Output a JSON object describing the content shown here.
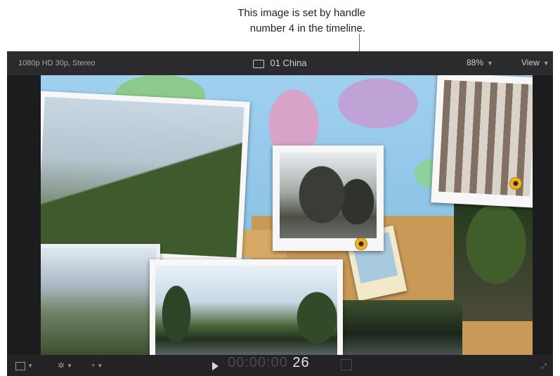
{
  "callout": {
    "line1": "This image is set by handle",
    "line2": "number 4 in the timeline."
  },
  "viewer": {
    "format_label": "1080p HD 30p, Stereo",
    "clip_name": "01 China",
    "zoom": "88%",
    "view_menu": "View",
    "timecode_dim": "00:00:00",
    "timecode_frames": "26"
  },
  "icons": {
    "clip_icon": "film-icon",
    "play": "play-icon",
    "crop": "crop-icon",
    "transform": "transform-icon",
    "retime": "speedometer-icon"
  },
  "colors": {
    "handle_accent": "#f3b21f",
    "viewer_bg": "#1c1c1e"
  }
}
